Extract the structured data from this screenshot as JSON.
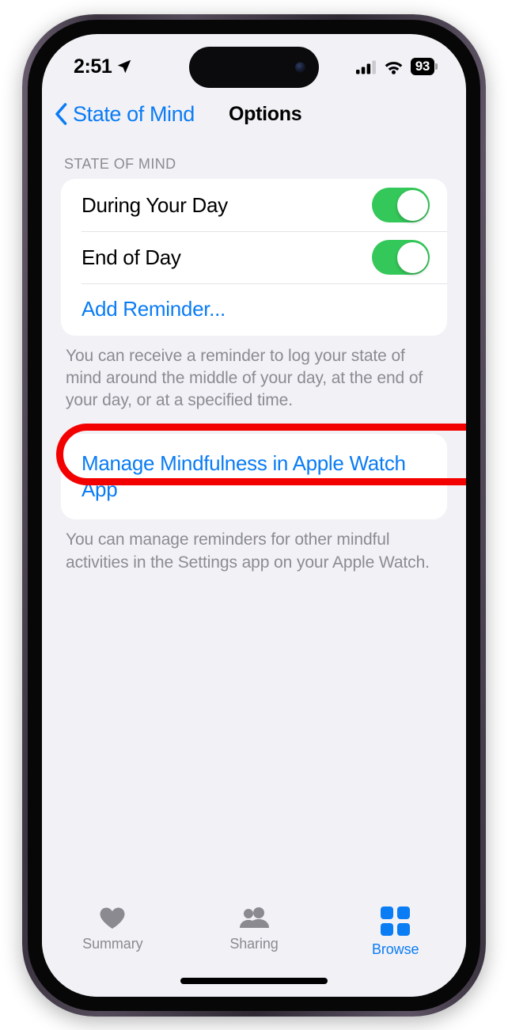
{
  "status_bar": {
    "time": "2:51",
    "location_icon": "location-arrow-icon",
    "cellular_icon": "cellular-bars-icon",
    "wifi_icon": "wifi-icon",
    "battery_percent": "93"
  },
  "nav": {
    "back_label": "State of Mind",
    "back_icon": "chevron-left-icon",
    "title": "Options"
  },
  "sections": [
    {
      "header": "STATE OF MIND",
      "rows": [
        {
          "label": "During Your Day",
          "type": "toggle",
          "value": "on"
        },
        {
          "label": "End of Day",
          "type": "toggle",
          "value": "on"
        },
        {
          "label": "Add Reminder...",
          "type": "link"
        }
      ],
      "footer": "You can receive a reminder to log your state of mind around the middle of your day, at the end of your day, or at a specified time."
    },
    {
      "header": "",
      "rows": [
        {
          "label": "Manage Mindfulness in Apple Watch App",
          "type": "link"
        }
      ],
      "footer": "You can manage reminders for other mindful activities in the Settings app on your Apple Watch."
    }
  ],
  "annotation": {
    "shape": "red-oval-highlight",
    "target": "Add Reminder...",
    "color": "#F30000"
  },
  "tab_bar": {
    "tabs": [
      {
        "label": "Summary",
        "icon": "heart-icon",
        "active": false
      },
      {
        "label": "Sharing",
        "icon": "people-icon",
        "active": false
      },
      {
        "label": "Browse",
        "icon": "grid-icon",
        "active": true
      }
    ]
  },
  "colors": {
    "accent_blue": "#0A7CF4",
    "toggle_green": "#34C759",
    "background": "#F2F1F6",
    "card": "#FFFFFF",
    "secondary_text": "#8B8B92"
  }
}
